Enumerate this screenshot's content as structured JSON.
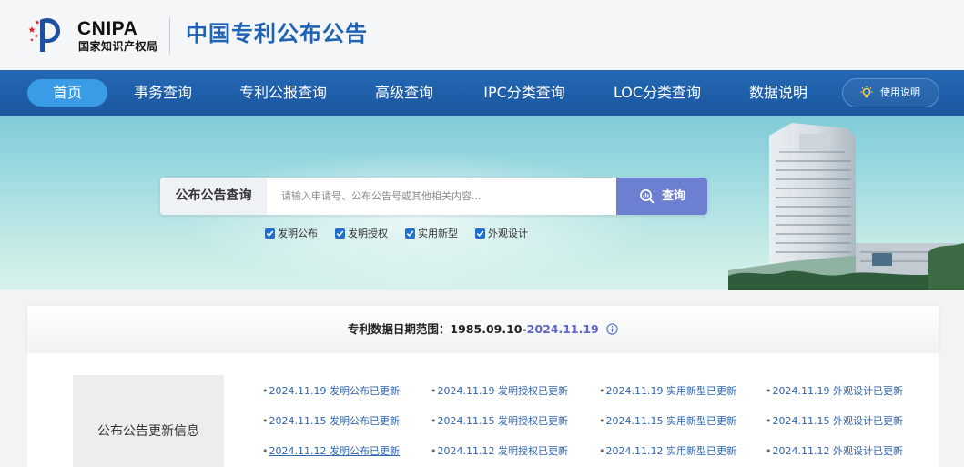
{
  "header": {
    "logo_en": "CNIPA",
    "logo_cn": "国家知识产权局",
    "site_title": "中国专利公布公告"
  },
  "nav": {
    "items": [
      {
        "label": "首页",
        "active": true
      },
      {
        "label": "事务查询"
      },
      {
        "label": "专利公报查询"
      },
      {
        "label": "高级查询"
      },
      {
        "label": "IPC分类查询"
      },
      {
        "label": "LOC分类查询"
      },
      {
        "label": "数据说明"
      }
    ],
    "help_label": "使用说明",
    "help_icon": "lightbulb-icon"
  },
  "search": {
    "category_label": "公布公告查询",
    "placeholder": "请输入申请号、公布公告号或其他相关内容...",
    "button_label": "查询",
    "button_icon": "search-icon",
    "filters": [
      {
        "label": "发明公布",
        "checked": true
      },
      {
        "label": "发明授权",
        "checked": true
      },
      {
        "label": "实用新型",
        "checked": true
      },
      {
        "label": "外观设计",
        "checked": true
      }
    ]
  },
  "date_range": {
    "prefix": "专利数据日期范围：",
    "start": "1985.09.10-",
    "end": "2024.11.19",
    "info_icon": "info-icon"
  },
  "updates": {
    "label": "公布公告更新信息",
    "rows": [
      [
        "2024.11.19 发明公布已更新",
        "2024.11.19 发明授权已更新",
        "2024.11.19 实用新型已更新",
        "2024.11.19 外观设计已更新"
      ],
      [
        "2024.11.15 发明公布已更新",
        "2024.11.15 发明授权已更新",
        "2024.11.15 实用新型已更新",
        "2024.11.15 外观设计已更新"
      ],
      [
        "2024.11.12 发明公布已更新",
        "2024.11.12 发明授权已更新",
        "2024.11.12 实用新型已更新",
        "2024.11.12 外观设计已更新"
      ]
    ]
  },
  "colors": {
    "nav_bg": "#1d5ca6",
    "nav_active": "#3a9ce6",
    "title_blue": "#1e63b4",
    "search_button": "#6d7fd0",
    "link_blue": "#2f64b0",
    "date_accent": "#6066c8"
  }
}
